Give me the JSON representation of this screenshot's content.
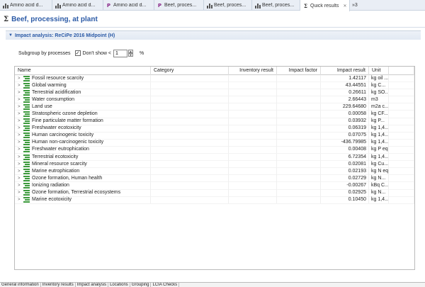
{
  "tabs": [
    {
      "label": "Amino acid d...",
      "icon": "bar-chart-icon"
    },
    {
      "label": "Amino acid d...",
      "icon": "bar-chart-icon"
    },
    {
      "label": "Amino acid d...",
      "icon": "process-icon"
    },
    {
      "label": "Beef, proces...",
      "icon": "process-icon"
    },
    {
      "label": "Beef, proces...",
      "icon": "bar-chart-icon"
    },
    {
      "label": "Beef, proces...",
      "icon": "bar-chart-icon"
    },
    {
      "label": "Quick results",
      "icon": "sigma-icon",
      "active": true
    },
    {
      "label": "»3",
      "icon": ""
    }
  ],
  "editor": {
    "title": "Beef, processing, at plant"
  },
  "section": {
    "title": "Impact analysis: ReCiPe 2016 Midpoint (H)"
  },
  "controls": {
    "subgroup_label": "Subgroup by processes",
    "dont_show_label": "Don't show <",
    "dont_show_value": "1",
    "percent_label": "%"
  },
  "table": {
    "columns": {
      "name": "Name",
      "category": "Category",
      "inventory": "Inventory result",
      "factor": "Impact factor",
      "result": "Impact result",
      "unit": "Unit"
    },
    "rows": [
      {
        "name": "Fossil resource scarcity",
        "result": "1.42117",
        "unit": "kg oil ..."
      },
      {
        "name": "Global warming",
        "result": "43.44551",
        "unit": "kg C..."
      },
      {
        "name": "Terrestrial acidification",
        "result": "0.26611",
        "unit": "kg SO..."
      },
      {
        "name": "Water consumption",
        "result": "2.66443",
        "unit": "m3"
      },
      {
        "name": "Land use",
        "result": "229.64680",
        "unit": "m2a c..."
      },
      {
        "name": "Stratospheric ozone depletion",
        "result": "0.00058",
        "unit": "kg CF..."
      },
      {
        "name": "Fine particulate matter formation",
        "result": "0.03932",
        "unit": "kg P..."
      },
      {
        "name": "Freshwater ecotoxicity",
        "result": "0.06319",
        "unit": "kg 1,4..."
      },
      {
        "name": "Human carcinogenic toxicity",
        "result": "0.07075",
        "unit": "kg 1,4..."
      },
      {
        "name": "Human non-carcinogenic toxicity",
        "result": "-436.79985",
        "unit": "kg 1,4..."
      },
      {
        "name": "Freshwater eutrophication",
        "result": "0.00408",
        "unit": "kg P eq"
      },
      {
        "name": "Terrestrial ecotoxicity",
        "result": "6.72354",
        "unit": "kg 1,4..."
      },
      {
        "name": "Mineral resource scarcity",
        "result": "0.02081",
        "unit": "kg Cu..."
      },
      {
        "name": "Marine eutrophication",
        "result": "0.02193",
        "unit": "kg N eq"
      },
      {
        "name": "Ozone formation, Human health",
        "result": "0.02729",
        "unit": "kg N..."
      },
      {
        "name": "Ionizing radiation",
        "result": "-0.00267",
        "unit": "kBq C..."
      },
      {
        "name": "Ozone formation, Terrestrial ecosystems",
        "result": "0.02925",
        "unit": "kg N..."
      },
      {
        "name": "Marine ecotoxicity",
        "result": "0.10450",
        "unit": "kg 1,4..."
      }
    ]
  },
  "bottom_tabs": [
    "General information",
    "Inventory results",
    "Impact analysis",
    "Locations",
    "Grouping",
    "LCIA Checks"
  ],
  "colors": {
    "accent": "#2b5aa6",
    "impact_icon": "#3c9a3c",
    "process_icon": "#8a2a8a"
  }
}
